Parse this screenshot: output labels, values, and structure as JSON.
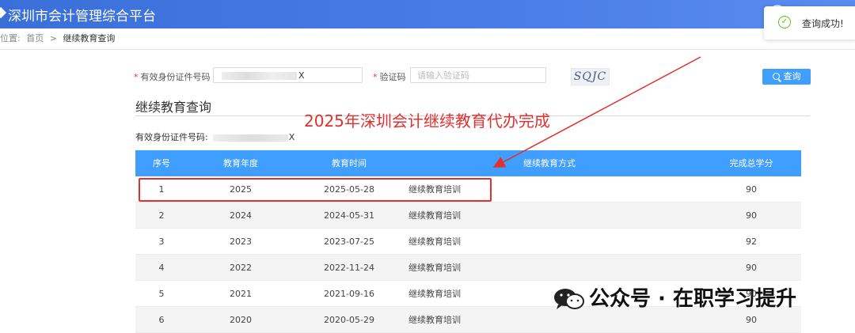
{
  "header": {
    "app_title": "深圳市会计管理综合平台"
  },
  "breadcrumb": {
    "prefix": "位置:",
    "home": "首页",
    "separator": ">",
    "current": "继续教育查询"
  },
  "toast": {
    "message": "查询成功!",
    "color": "#52c41a"
  },
  "form": {
    "id_label": "有效身份证件号码",
    "id_value_suffix": "X",
    "captcha_label": "验证码",
    "captcha_placeholder": "请输入验证码",
    "captcha_text": "SQJC",
    "search_label": "查询",
    "required_mark": "*"
  },
  "section": {
    "title": "继续教育查询",
    "id_summary_label": "有效身份证件号码:",
    "id_summary_suffix": "X"
  },
  "table": {
    "headers": [
      "序号",
      "教育年度",
      "教育时间",
      "继续教育方式",
      "完成总学分"
    ],
    "rows": [
      {
        "seq": "1",
        "year": "2025",
        "time": "2025-05-28",
        "mode": "继续教育培训",
        "credits": "90"
      },
      {
        "seq": "2",
        "year": "2024",
        "time": "2024-05-31",
        "mode": "继续教育培训",
        "credits": "90"
      },
      {
        "seq": "3",
        "year": "2023",
        "time": "2023-07-25",
        "mode": "继续教育培训",
        "credits": "92"
      },
      {
        "seq": "4",
        "year": "2022",
        "time": "2022-11-24",
        "mode": "继续教育培训",
        "credits": "90"
      },
      {
        "seq": "5",
        "year": "2021",
        "time": "2021-09-16",
        "mode": "继续教育培训",
        "credits": "90"
      },
      {
        "seq": "6",
        "year": "2020",
        "time": "2020-05-29",
        "mode": "继续教育培训",
        "credits": "90"
      }
    ],
    "header_color": "#409eff"
  },
  "annotation": {
    "text": "2025年深圳会计继续教育代办完成",
    "color": "#e23030"
  },
  "watermark": {
    "text": "公众号 · 在职学习提升",
    "icon": "wechat-icon"
  }
}
